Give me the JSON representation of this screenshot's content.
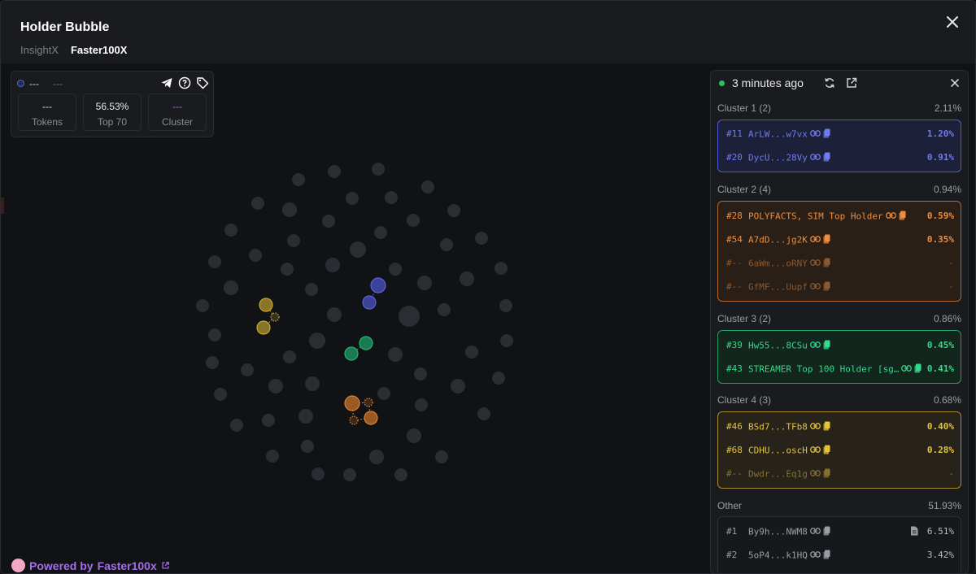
{
  "header": {
    "title": "Holder Bubble",
    "tabs": [
      {
        "label": "InsightX",
        "active": false
      },
      {
        "label": "Faster100X",
        "active": true
      }
    ]
  },
  "info_card": {
    "name": "---",
    "address": "---",
    "stats": [
      {
        "value": "---",
        "label": "Tokens"
      },
      {
        "value": "56.53%",
        "label": "Top 70"
      },
      {
        "value": "---",
        "label": "Cluster"
      }
    ],
    "icons": [
      "telegram-icon",
      "help-icon",
      "tag-icon"
    ]
  },
  "panel": {
    "updated": "3 minutes ago",
    "clusters": [
      {
        "name": "Cluster 1 (2)",
        "pct": "2.11%",
        "rows": [
          {
            "rank": "#11",
            "addr": "ArLW...w7vx",
            "pct": "1.20%"
          },
          {
            "rank": "#20",
            "addr": "DycU...28Vy",
            "pct": "0.91%"
          }
        ]
      },
      {
        "name": "Cluster 2 (4)",
        "pct": "0.94%",
        "rows": [
          {
            "rank": "#28",
            "addr": "POLYFACTS, SIM Top Holder",
            "pct": "0.59%"
          },
          {
            "rank": "#54",
            "addr": "A7dD...jg2K",
            "pct": "0.35%"
          },
          {
            "rank": "#--",
            "addr": "6aWm...oRNY",
            "pct": "-"
          },
          {
            "rank": "#--",
            "addr": "GfMF...Uupf",
            "pct": "-"
          }
        ]
      },
      {
        "name": "Cluster 3 (2)",
        "pct": "0.86%",
        "rows": [
          {
            "rank": "#39",
            "addr": "Hw55...8CSu",
            "pct": "0.45%"
          },
          {
            "rank": "#43",
            "addr": "STREAMER Top 100 Holder [sg…",
            "pct": "0.41%"
          }
        ]
      },
      {
        "name": "Cluster 4 (3)",
        "pct": "0.68%",
        "rows": [
          {
            "rank": "#46",
            "addr": "BSd7...TFb8",
            "pct": "0.40%"
          },
          {
            "rank": "#68",
            "addr": "CDHU...oscH",
            "pct": "0.28%"
          },
          {
            "rank": "#--",
            "addr": "Dwdr...Eq1g",
            "pct": "-"
          }
        ]
      }
    ],
    "other": {
      "name": "Other",
      "pct": "51.93%",
      "rows": [
        {
          "rank": "#1",
          "addr": "By9h...NWM8",
          "pct": "6.51%"
        },
        {
          "rank": "#2",
          "addr": "5oP4...k1HQ",
          "pct": "3.42%"
        }
      ]
    }
  },
  "footer": {
    "powered_label": "Powered by",
    "brand": "Faster100x"
  },
  "colors": {
    "cluster1": "#5a66d8",
    "cluster2": "#e0802f",
    "cluster3": "#22b573",
    "cluster4": "#c9a838",
    "bubble": "#2b2d33"
  }
}
